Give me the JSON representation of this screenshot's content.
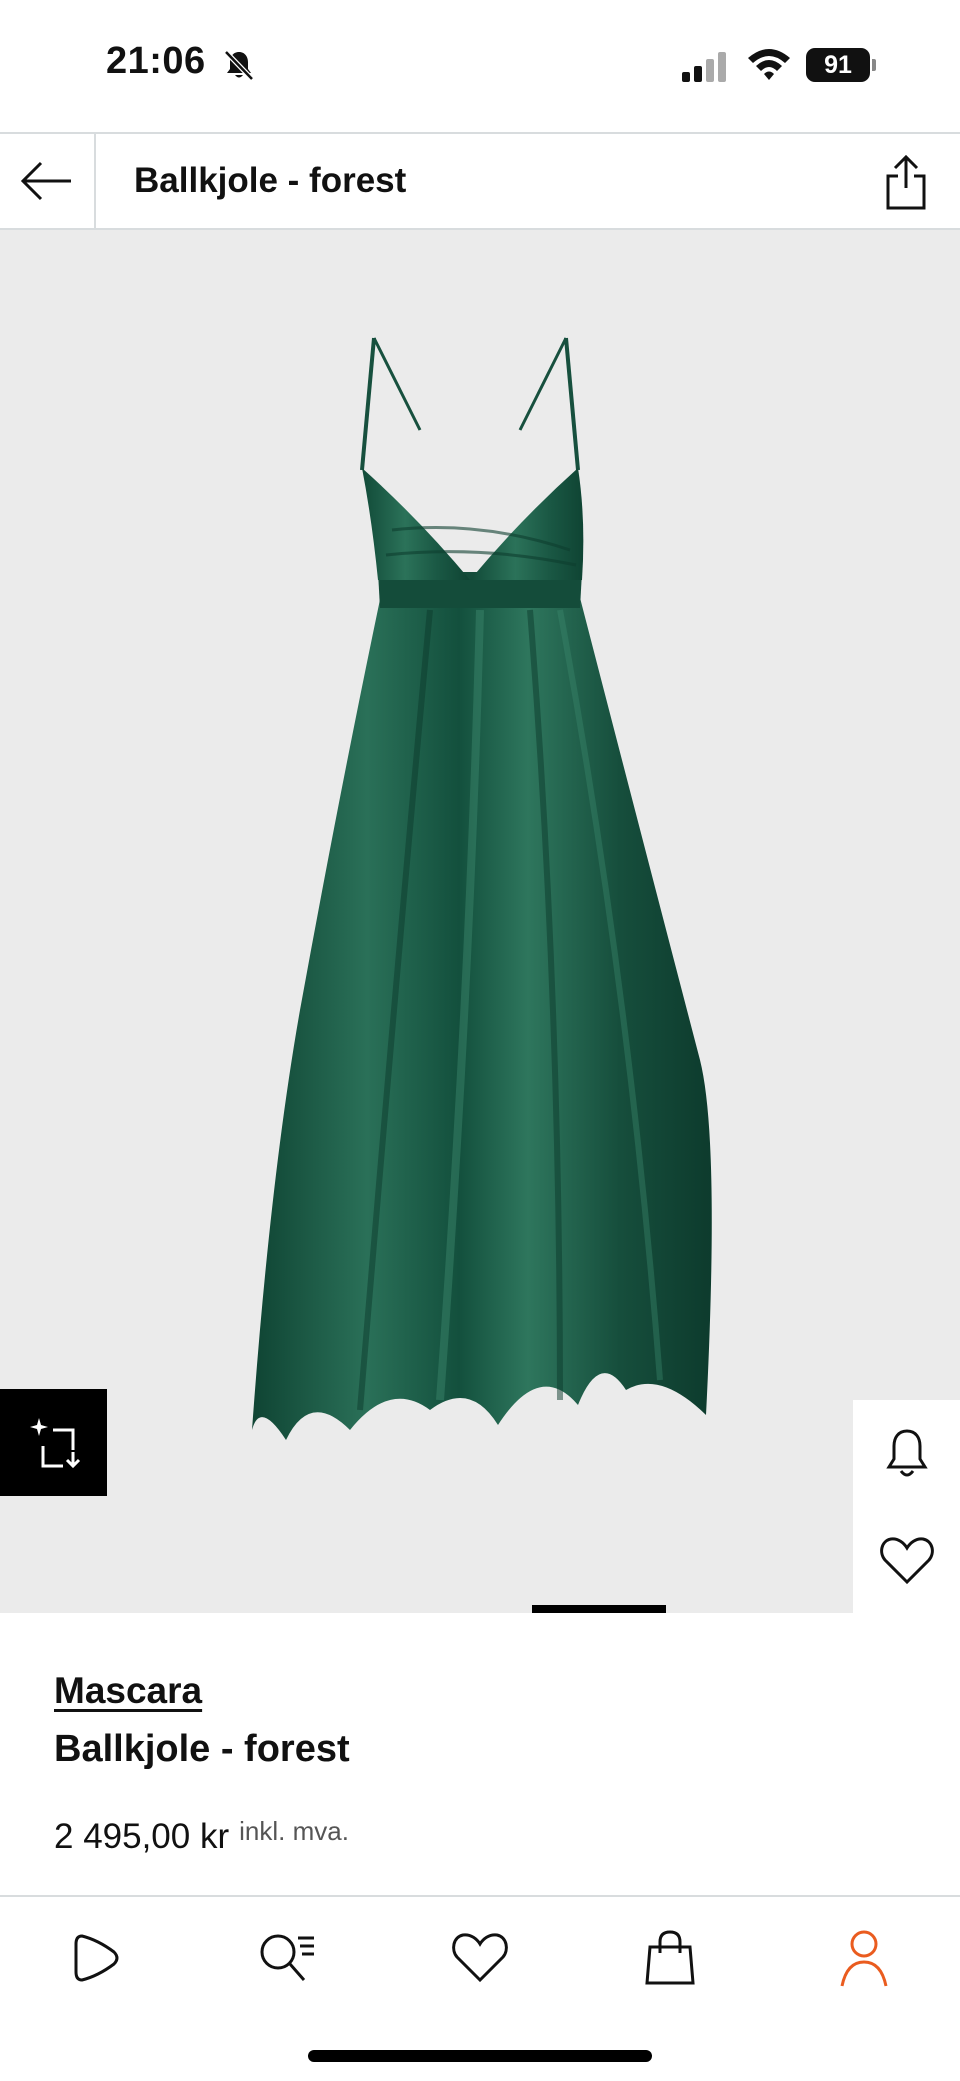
{
  "status_bar": {
    "time": "21:06",
    "battery": "91",
    "icons": [
      "bell-slash-icon",
      "cellular-signal-icon",
      "wifi-icon",
      "battery-icon"
    ]
  },
  "header": {
    "title": "Ballkjole - forest",
    "back_icon": "arrow-left-icon",
    "share_icon": "share-icon"
  },
  "gallery": {
    "current_image": 1,
    "side_actions": [
      "bell-icon",
      "heart-icon"
    ],
    "try_on_icon": "sparkle-rotate-icon"
  },
  "product": {
    "brand": "Mascara",
    "name": "Ballkjole - forest",
    "price": "2 495,00 kr",
    "vat_note": "inkl. mva."
  },
  "bottom_nav": {
    "items": [
      "play-icon",
      "search-list-icon",
      "heart-icon",
      "shopping-bag-icon",
      "user-icon"
    ],
    "active_index": 4
  },
  "colors": {
    "accent": "#ea5c1f",
    "dress": "#1c5a45",
    "background": "#ebebeb",
    "divider": "#d8dcde"
  }
}
